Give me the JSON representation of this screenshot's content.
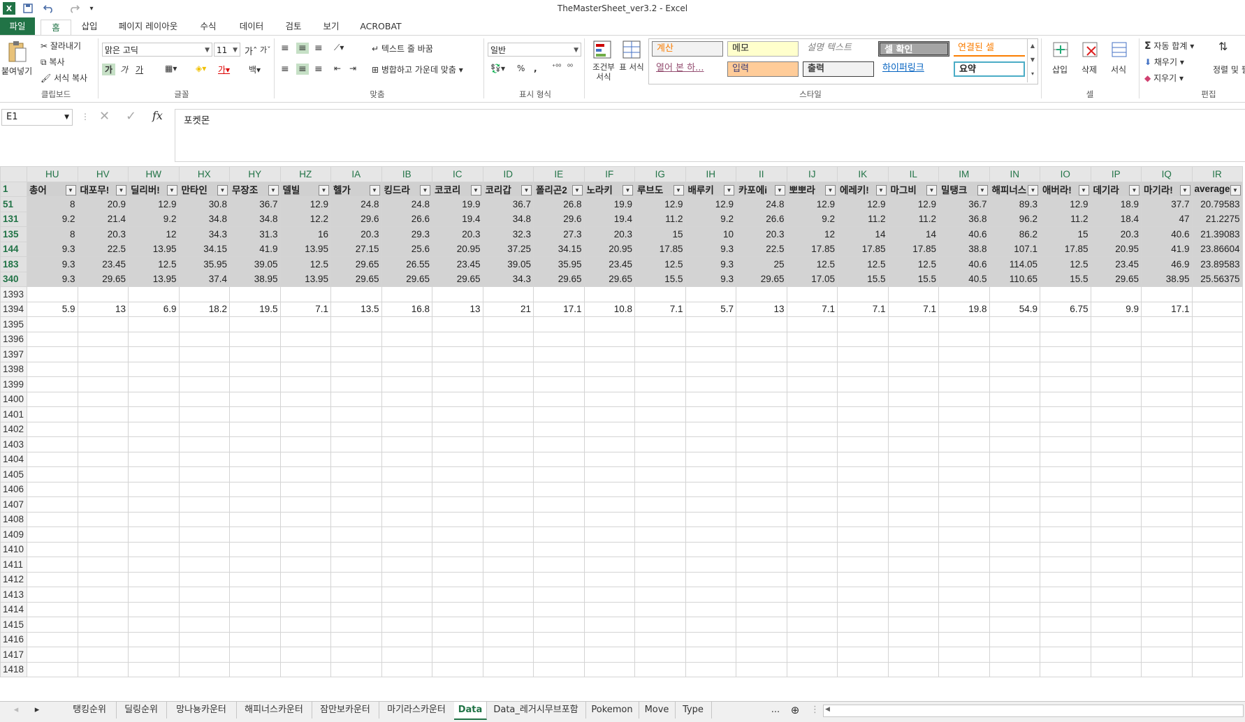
{
  "titlebar": {
    "title": "TheMasterSheet_ver3.2 - Excel",
    "save_icon": "save-icon",
    "undo_icon": "undo-icon",
    "redo_icon": "redo-icon",
    "excel_logo": "X"
  },
  "menu": {
    "file": "파일",
    "tabs": [
      "홈",
      "삽입",
      "페이지 레이아웃",
      "수식",
      "데이터",
      "검토",
      "보기",
      "ACROBAT"
    ]
  },
  "ribbon": {
    "clipboard": {
      "paste": "붙여넣기",
      "cut": "잘라내기",
      "copy": "복사",
      "format_copy": "서식 복사",
      "label": "클립보드"
    },
    "font": {
      "name": "맑은 고딕",
      "size": "11",
      "label": "글꼴",
      "bold": "가",
      "italic": "가",
      "underline": "가"
    },
    "align": {
      "wrap": "텍스트 줄 바꿈",
      "merge": "병합하고 가운데 맞춤",
      "label": "맞춤"
    },
    "number": {
      "format": "일반",
      "label": "표시 형식",
      "percent": "%",
      "comma": ","
    },
    "styles": {
      "cond_format": "조건부 서식",
      "table_format": "표 서식",
      "cells": [
        "계산",
        "메모",
        "설명 텍스트",
        "셀 확인",
        "연결된 셀",
        "열어 본 하...",
        "입력",
        "출력",
        "하이퍼링크",
        "요약"
      ],
      "label": "스타일"
    },
    "cells": {
      "insert": "삽입",
      "delete": "삭제",
      "format": "서식",
      "label": "셀"
    },
    "editing": {
      "autosum": "자동 합계",
      "fill": "채우기",
      "clear": "지우기",
      "sort": "정렬 및 필터",
      "label": "편집"
    }
  },
  "formula_bar": {
    "name_box": "E1",
    "content": "포켓몬",
    "fx": "fx"
  },
  "sheet": {
    "columns": [
      "HU",
      "HV",
      "HW",
      "HX",
      "HY",
      "HZ",
      "IA",
      "IB",
      "IC",
      "ID",
      "IE",
      "IF",
      "IG",
      "IH",
      "II",
      "IJ",
      "IK",
      "IL",
      "IM",
      "IN",
      "IO",
      "IP",
      "IQ",
      "IR"
    ],
    "header_row_num": "1",
    "headers": [
      "총어",
      "대포무!",
      "딜리버!",
      "만타인",
      "무장조",
      "델빌",
      "헬가",
      "킹드라",
      "코코리",
      "코리갑",
      "폴리곤2",
      "노라키",
      "루브도",
      "배루키",
      "카포에i",
      "뽀뽀라",
      "에레키!",
      "마그비",
      "밀탱크",
      "해피너스",
      "애버라!",
      "데기라",
      "마기라!",
      "average"
    ],
    "rows": [
      {
        "num": "51",
        "values": [
          "8",
          "20.9",
          "12.9",
          "30.8",
          "36.7",
          "12.9",
          "24.8",
          "24.8",
          "19.9",
          "36.7",
          "26.8",
          "19.9",
          "12.9",
          "12.9",
          "24.8",
          "12.9",
          "12.9",
          "12.9",
          "36.7",
          "89.3",
          "12.9",
          "18.9",
          "37.7",
          "20.79583"
        ]
      },
      {
        "num": "131",
        "values": [
          "9.2",
          "21.4",
          "9.2",
          "34.8",
          "34.8",
          "12.2",
          "29.6",
          "26.6",
          "19.4",
          "34.8",
          "29.6",
          "19.4",
          "11.2",
          "9.2",
          "26.6",
          "9.2",
          "11.2",
          "11.2",
          "36.8",
          "96.2",
          "11.2",
          "18.4",
          "47",
          "21.2275"
        ]
      },
      {
        "num": "135",
        "values": [
          "8",
          "20.3",
          "12",
          "34.3",
          "31.3",
          "16",
          "20.3",
          "29.3",
          "20.3",
          "32.3",
          "27.3",
          "20.3",
          "15",
          "10",
          "20.3",
          "12",
          "14",
          "14",
          "40.6",
          "86.2",
          "15",
          "20.3",
          "40.6",
          "21.39083"
        ]
      },
      {
        "num": "144",
        "values": [
          "9.3",
          "22.5",
          "13.95",
          "34.15",
          "41.9",
          "13.95",
          "27.15",
          "25.6",
          "20.95",
          "37.25",
          "34.15",
          "20.95",
          "17.85",
          "9.3",
          "22.5",
          "17.85",
          "17.85",
          "17.85",
          "38.8",
          "107.1",
          "17.85",
          "20.95",
          "41.9",
          "23.86604"
        ]
      },
      {
        "num": "183",
        "values": [
          "9.3",
          "23.45",
          "12.5",
          "35.95",
          "39.05",
          "12.5",
          "29.65",
          "26.55",
          "23.45",
          "39.05",
          "35.95",
          "23.45",
          "12.5",
          "9.3",
          "25",
          "12.5",
          "12.5",
          "12.5",
          "40.6",
          "114.05",
          "12.5",
          "23.45",
          "46.9",
          "23.89583"
        ]
      },
      {
        "num": "340",
        "values": [
          "9.3",
          "29.65",
          "13.95",
          "37.4",
          "38.95",
          "13.95",
          "29.65",
          "29.65",
          "29.65",
          "34.3",
          "29.65",
          "29.65",
          "15.5",
          "9.3",
          "29.65",
          "17.05",
          "15.5",
          "15.5",
          "40.5",
          "110.65",
          "15.5",
          "29.65",
          "38.95",
          "25.56375"
        ]
      }
    ],
    "row_1393": {
      "num": "1393",
      "values": [
        "",
        "",
        "",
        "",
        "",
        "",
        "",
        "",
        "",
        "",
        "",
        "",
        "",
        "",
        "",
        "",
        "",
        "",
        "",
        "",
        "",
        "",
        "",
        ""
      ]
    },
    "row_1394": {
      "num": "1394",
      "values": [
        "5.9",
        "13",
        "6.9",
        "18.2",
        "19.5",
        "7.1",
        "13.5",
        "16.8",
        "13",
        "21",
        "17.1",
        "10.8",
        "7.1",
        "5.7",
        "13",
        "7.1",
        "7.1",
        "7.1",
        "19.8",
        "54.9",
        "6.75",
        "9.9",
        "17.1",
        ""
      ]
    },
    "empty_rows": [
      "1395",
      "1396",
      "1397",
      "1398",
      "1399",
      "1400",
      "1401",
      "1402",
      "1403",
      "1404",
      "1405",
      "1406",
      "1407",
      "1408",
      "1409",
      "1410",
      "1411",
      "1412",
      "1413",
      "1414",
      "1415",
      "1416",
      "1417",
      "1418"
    ]
  },
  "sheet_tabs": {
    "tabs": [
      "탱킹순위",
      "딜링순위",
      "망나뇽카운터",
      "해피너스카운터",
      "잠만보카운터",
      "마기라스카운터",
      "Data",
      "Data_레거시무브포함",
      "Pokemon",
      "Move",
      "Type"
    ],
    "active": "Data",
    "more": "...",
    "add": "⊕"
  }
}
